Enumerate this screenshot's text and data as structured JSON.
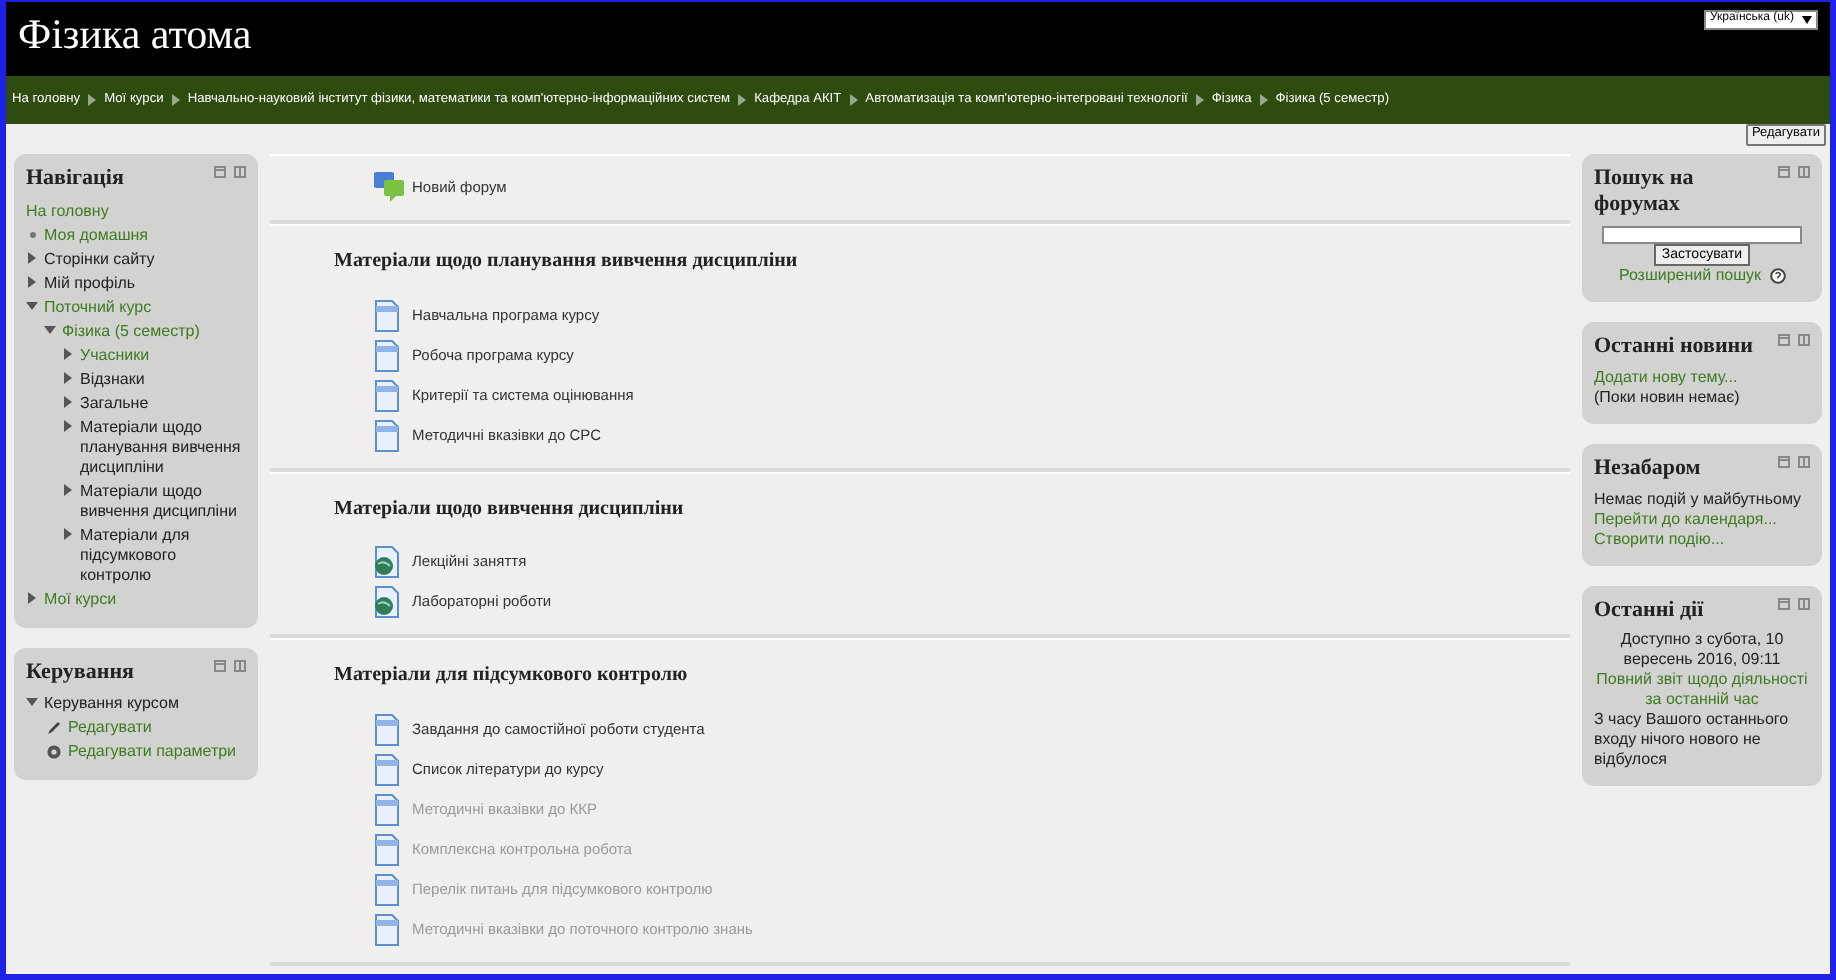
{
  "header": {
    "title": "Фізика атома",
    "language": "Українська (uk)"
  },
  "breadcrumb": [
    "На головну",
    "Мої курси",
    "Навчально-науковий інститут фізики, математики та комп'ютерно-інформаційних систем",
    "Кафедра АКІТ",
    "Автоматизація та комп'ютерно-інтегровані технології",
    "Фізика",
    "Фізика (5 семестр)"
  ],
  "edit_button": "Редагувати",
  "navigation": {
    "title": "Навігація",
    "items": [
      {
        "label": "На головну",
        "kind": "plain",
        "link": true
      },
      {
        "label": "Моя домашня",
        "kind": "leaf",
        "link": true
      },
      {
        "label": "Сторінки сайту",
        "kind": "branch",
        "expanded": false,
        "link": false
      },
      {
        "label": "Мій профіль",
        "kind": "branch",
        "expanded": false,
        "link": false
      },
      {
        "label": "Поточний курс",
        "kind": "branch",
        "expanded": true,
        "link": true,
        "children": [
          {
            "label": "Фізика (5 семестр)",
            "kind": "branch",
            "expanded": true,
            "link": true,
            "children": [
              {
                "label": "Учасники",
                "kind": "branch",
                "expanded": false,
                "link": true
              },
              {
                "label": "Відзнаки",
                "kind": "branch",
                "expanded": false,
                "link": false
              },
              {
                "label": "Загальне",
                "kind": "branch",
                "expanded": false,
                "link": false
              },
              {
                "label": "Матеріали щодо планування вивчення дисципліни",
                "kind": "branch",
                "expanded": false,
                "link": false
              },
              {
                "label": "Матеріали щодо вивчення дисципліни",
                "kind": "branch",
                "expanded": false,
                "link": false
              },
              {
                "label": "Матеріали для підсумкового контролю",
                "kind": "branch",
                "expanded": false,
                "link": false
              }
            ]
          }
        ]
      },
      {
        "label": "Мої курси",
        "kind": "branch",
        "expanded": false,
        "link": true
      }
    ]
  },
  "administration": {
    "title": "Керування",
    "items": [
      {
        "label": "Керування курсом",
        "kind": "branch",
        "expanded": true,
        "link": false,
        "children": [
          {
            "label": "Редагувати",
            "kind": "edit",
            "link": true
          },
          {
            "label": "Редагувати параметри",
            "kind": "settings",
            "link": true
          }
        ]
      }
    ]
  },
  "sections": [
    {
      "items": [
        {
          "label": "Новий форум",
          "kind": "forum",
          "dimmed": false
        }
      ]
    },
    {
      "title": "Матеріали щодо планування вивчення дисципліни",
      "items": [
        {
          "label": "Навчальна програма курсу",
          "kind": "file",
          "dimmed": false
        },
        {
          "label": "Робоча програма курсу",
          "kind": "file",
          "dimmed": false
        },
        {
          "label": "Критерії та система оцінювання",
          "kind": "file",
          "dimmed": false
        },
        {
          "label": "Методичні вказівки до СРС",
          "kind": "file",
          "dimmed": false
        }
      ]
    },
    {
      "title": "Матеріали щодо вивчення дисципліни",
      "items": [
        {
          "label": "Лекційні заняття",
          "kind": "url",
          "dimmed": false
        },
        {
          "label": "Лабораторні роботи",
          "kind": "url",
          "dimmed": false
        }
      ]
    },
    {
      "title": "Матеріали для підсумкового контролю",
      "items": [
        {
          "label": "Завдання до самостійної роботи студента",
          "kind": "file",
          "dimmed": false
        },
        {
          "label": "Список літератури до курсу",
          "kind": "file",
          "dimmed": false
        },
        {
          "label": "Методичні вказівки до ККР",
          "kind": "file",
          "dimmed": true
        },
        {
          "label": "Комплексна контрольна робота",
          "kind": "file",
          "dimmed": true
        },
        {
          "label": "Перелік питань для підсумкового контролю",
          "kind": "file",
          "dimmed": true
        },
        {
          "label": "Методичні вказівки до поточного контролю знань",
          "kind": "file",
          "dimmed": true
        }
      ]
    }
  ],
  "right_blocks": [
    {
      "title": "Пошук на форумах",
      "lines": [
        {
          "kind": "search"
        },
        {
          "kind": "button",
          "text": "Застосувати"
        },
        {
          "kind": "help_link",
          "text": "Розширений пошук"
        }
      ]
    },
    {
      "title": "Останні новини",
      "lines": [
        {
          "kind": "link",
          "text": "Додати нову тему..."
        },
        {
          "kind": "text",
          "text": "(Поки новин немає)"
        }
      ]
    },
    {
      "title": "Незабаром",
      "lines": [
        {
          "kind": "text",
          "text": "Немає подій у майбутньому"
        },
        {
          "kind": "link",
          "text": "Перейти до календаря..."
        },
        {
          "kind": "link",
          "text": "Створити подію..."
        }
      ]
    },
    {
      "title": "Останні дії",
      "lines": [
        {
          "kind": "center_text",
          "text": "Доступно з субота, 10 вересень 2016, 09:11"
        },
        {
          "kind": "center_link",
          "text": "Повний звіт щодо діяльності за останній час"
        },
        {
          "kind": "text",
          "text": "З часу Вашого останнього входу нічого нового не відбулося"
        }
      ]
    }
  ]
}
